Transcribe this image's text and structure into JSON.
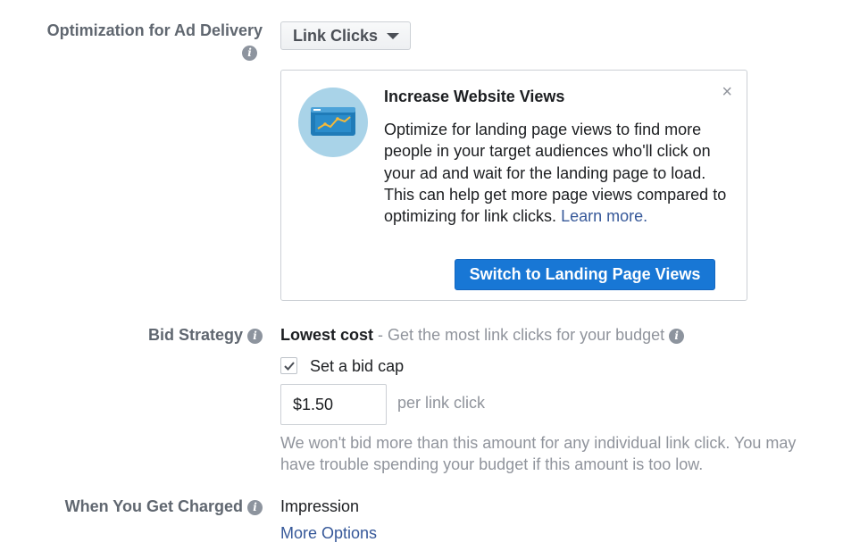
{
  "optimization": {
    "label": "Optimization for Ad Delivery",
    "selected": "Link Clicks"
  },
  "suggestion": {
    "title": "Increase Website Views",
    "body": "Optimize for landing page views to find more people in your target audiences who'll click on your ad and wait for the landing page to load. This can help get more page views compared to optimizing for link clicks.",
    "learn_more": "Learn more.",
    "button": "Switch to Landing Page Views",
    "close": "×"
  },
  "bid": {
    "label": "Bid Strategy",
    "strategy": "Lowest cost",
    "description": "- Get the most link clicks for your budget",
    "cap_label": "Set a bid cap",
    "cap_checked": true,
    "cap_value": "$1.50",
    "cap_unit": "per link click",
    "help": "We won't bid more than this amount for any individual link click. You may have trouble spending your budget if this amount is too low."
  },
  "charged": {
    "label": "When You Get Charged",
    "value": "Impression",
    "more_options": "More Options"
  },
  "icons": {
    "info": "i",
    "check": "check-icon",
    "caret": "caret-down-icon"
  },
  "colors": {
    "primary_button": "#1877d5",
    "link": "#365899",
    "muted": "#90949c",
    "illustration_bg": "#a9d3e8"
  }
}
